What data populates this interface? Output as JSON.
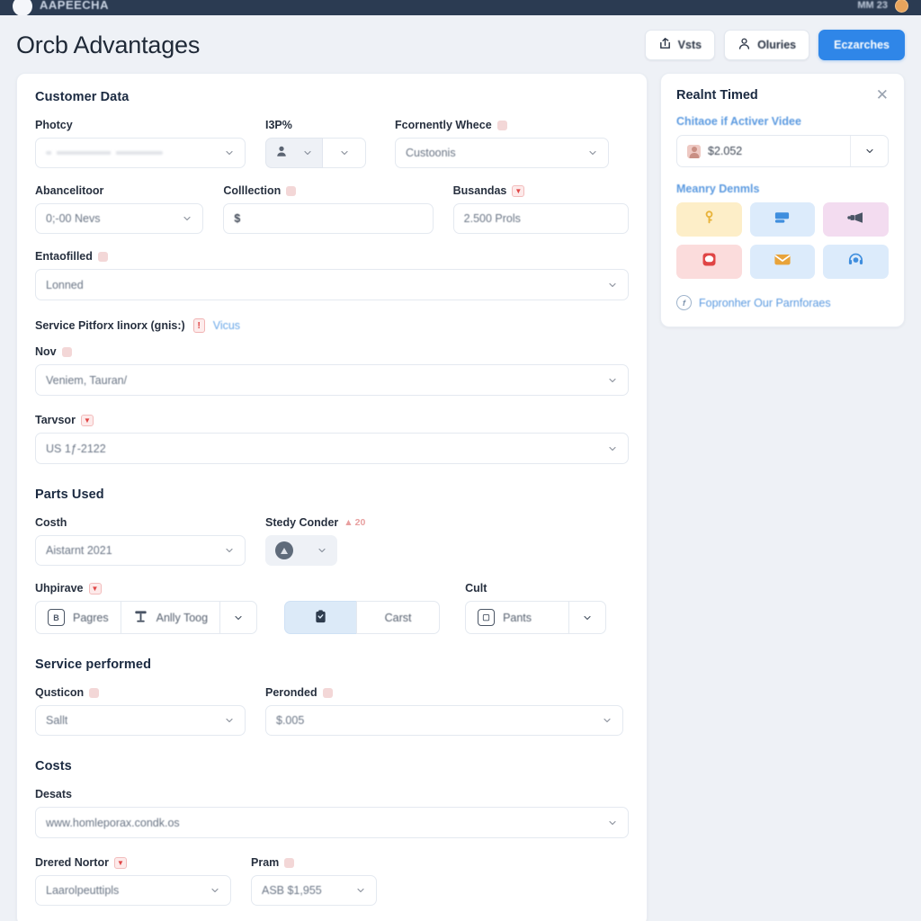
{
  "topnav": {
    "brand": "AAPEECHA",
    "right_text": "MM 23",
    "logo_icon": "circle-logo",
    "avatar_icon": "user-avatar"
  },
  "header": {
    "title": "Orcb Advantages",
    "buttons": [
      {
        "label": "Vsts",
        "icon": "share-export-icon",
        "variant": "ghost"
      },
      {
        "label": "Oluries",
        "icon": "user-icon",
        "variant": "ghost"
      },
      {
        "label": "Eczarches",
        "icon": "none",
        "variant": "primary"
      }
    ]
  },
  "main": {
    "sections": [
      {
        "id": "customer",
        "title": "Customer Data"
      },
      {
        "id": "parts",
        "title": "Parts Used"
      },
      {
        "id": "service",
        "title": "Service performed"
      },
      {
        "id": "costs",
        "title": "Costs"
      }
    ],
    "customer": {
      "photcy": {
        "label": "Photcy",
        "value": ""
      },
      "bp": {
        "label": "I3P%",
        "icon": "person-icon"
      },
      "fornently": {
        "label": "Fcornently Whece",
        "value": "Custoonis",
        "badge": "dot"
      },
      "abancelitoor": {
        "label": "Abancelitoor",
        "value": "0;-00 Nevs"
      },
      "colllection": {
        "label": "Colllection",
        "value": "$",
        "badge": "dot"
      },
      "busandas": {
        "label": "Busandas",
        "value": "2.500 Prols",
        "badge": "caret"
      },
      "entaofilled": {
        "label": "Entaofilled",
        "value": "Lonned",
        "badge": "dot"
      },
      "pitfork": {
        "label": "Service Pitforx Iinorx (gnis:)",
        "error_badge": "!",
        "link": "Vicus"
      },
      "now": {
        "label": "Nov",
        "value": "Veniem, Tauran/",
        "badge": "dot"
      },
      "tarvsor": {
        "label": "Tarvsor",
        "value": "US 1ƒ-2122",
        "badge": "caret"
      }
    },
    "parts": {
      "costh": {
        "label": "Costh",
        "value": "Aistarnt 2021"
      },
      "stedy": {
        "label": "Stedy Conder",
        "badge_up": "20"
      },
      "uhpirave": {
        "label": "Uhpirave",
        "badge": "caret",
        "buttons": [
          {
            "label": "Pagres",
            "icon": "page-icon"
          },
          {
            "label": "Anlly Toog",
            "icon": "text-tool-icon"
          },
          {
            "label": "",
            "icon": "chevron-down-icon"
          }
        ]
      },
      "middle_group": [
        {
          "label": "",
          "icon": "clipboard-icon",
          "active": true
        },
        {
          "label": "Carst",
          "icon": "none",
          "active": false
        }
      ],
      "cult": {
        "label": "Cult",
        "buttons": [
          {
            "label": "Pants",
            "icon": "page-icon"
          },
          {
            "label": "",
            "icon": "chevron-down-icon"
          }
        ]
      }
    },
    "service": {
      "qusticon": {
        "label": "Qusticon",
        "value": "Sallt",
        "badge": "dot"
      },
      "peronded": {
        "label": "Peronded",
        "value": "$.005",
        "badge": "dot"
      }
    },
    "costs": {
      "desats": {
        "label": "Desats",
        "value": "www.homleporax.condk.os"
      },
      "drered": {
        "label": "Drered Nortor",
        "value": "Laarolpeuttipls",
        "badge": "caret"
      },
      "pram": {
        "label": "Pram",
        "value": "ASB $1,955",
        "badge": "dot"
      }
    }
  },
  "sidebar": {
    "title": "Realnt Timed",
    "close_icon": "close-icon",
    "subtitle_1": "Chitaoe if Activer Videe",
    "select_value": "$2.052",
    "select_avatar": "user-avatar-icon",
    "subtitle_2": "Meanry Denmls",
    "tiles": [
      {
        "icon": "key-icon",
        "bg": "#fdeec8",
        "fg": "#e8b33a"
      },
      {
        "icon": "card-icon",
        "bg": "#dcebfb",
        "fg": "#3f8ede"
      },
      {
        "icon": "megaphone-icon",
        "bg": "#f3dcf0",
        "fg": "#4a5565"
      },
      {
        "icon": "chat-icon",
        "bg": "#fbdcdc",
        "fg": "#e04545"
      },
      {
        "icon": "envelope-icon",
        "bg": "#dcebfb",
        "fg": "#e8a33a"
      },
      {
        "icon": "headset-icon",
        "bg": "#dcebfb",
        "fg": "#3f8ede"
      }
    ],
    "footer_link": "Fopronher Our Parnforaes",
    "footer_icon": "info-circle-icon"
  },
  "colors": {
    "page_bg": "#eef1f6",
    "nav_bg": "#2b3b52",
    "primary": "#2f86e8",
    "link": "#5b9ae0",
    "danger": "#e04545",
    "card": "#ffffff",
    "border": "#e4e9f0",
    "text": "#1b2a41",
    "muted": "#6b7686"
  }
}
